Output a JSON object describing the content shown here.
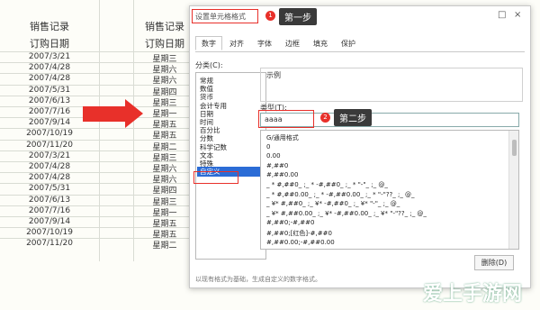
{
  "sheet": {
    "header_a": "销售记录",
    "header_b": "销售记录",
    "sub_a": "订购日期",
    "sub_b": "订购日期",
    "rows": [
      {
        "date": "2007/3/21",
        "day": "星期三"
      },
      {
        "date": "2007/4/28",
        "day": "星期六"
      },
      {
        "date": "2007/4/28",
        "day": "星期六"
      },
      {
        "date": "2007/5/31",
        "day": "星期四"
      },
      {
        "date": "2007/6/13",
        "day": "星期三"
      },
      {
        "date": "2007/7/16",
        "day": "星期一"
      },
      {
        "date": "2007/9/14",
        "day": "星期五"
      },
      {
        "date": "2007/10/19",
        "day": "星期五"
      },
      {
        "date": "2007/11/20",
        "day": "星期二"
      },
      {
        "date": "2007/3/21",
        "day": "星期三"
      },
      {
        "date": "2007/4/28",
        "day": "星期六"
      },
      {
        "date": "2007/4/28",
        "day": "星期六"
      },
      {
        "date": "2007/5/31",
        "day": "星期四"
      },
      {
        "date": "2007/6/13",
        "day": "星期三"
      },
      {
        "date": "2007/7/16",
        "day": "星期一"
      },
      {
        "date": "2007/9/14",
        "day": "星期五"
      },
      {
        "date": "2007/10/19",
        "day": "星期五"
      },
      {
        "date": "2007/11/20",
        "day": "星期二"
      }
    ]
  },
  "dialog": {
    "title": "设置单元格格式",
    "close": "×",
    "minimize": "□",
    "step1_badge": "1",
    "step1_label": "第一步",
    "step2_badge": "2",
    "step2_label": "第二步",
    "tabs": [
      "数字",
      "对齐",
      "字体",
      "边框",
      "填充",
      "保护"
    ],
    "category_label": "分类(C):",
    "categories": [
      "常规",
      "数值",
      "货币",
      "会计专用",
      "日期",
      "时间",
      "百分比",
      "分数",
      "科学记数",
      "文本",
      "特殊",
      "自定义"
    ],
    "selected_category": "自定义",
    "sample_label": "示例",
    "type_label": "类型(T):",
    "type_value": "aaaa",
    "formats": [
      "G/通用格式",
      "0",
      "0.00",
      "#,##0",
      "#,##0.00",
      "_ * #,##0_ ;_ * -#,##0_ ;_ * \"-\"_ ;_ @_",
      "_ * #,##0.00_ ;_ * -#,##0.00_ ;_ * \"-\"??_ ;_ @_",
      "_ ¥* #,##0_ ;_ ¥* -#,##0_ ;_ ¥* \"-\"_ ;_ @_",
      "_ ¥* #,##0.00_ ;_ ¥* -#,##0.00_ ;_ ¥* \"-\"??_ ;_ @_",
      "#,##0;-#,##0",
      "#,##0;[红色]-#,##0",
      "#,##0.00;-#,##0.00"
    ],
    "delete_label": "删除(D)",
    "hint": "以现有格式为基础，生成自定义的数字格式。"
  },
  "watermark": "爱上手游网",
  "colors": {
    "accent": "#e8302a",
    "step_bg": "#3a3a3a",
    "selected": "#2b6cd6"
  }
}
